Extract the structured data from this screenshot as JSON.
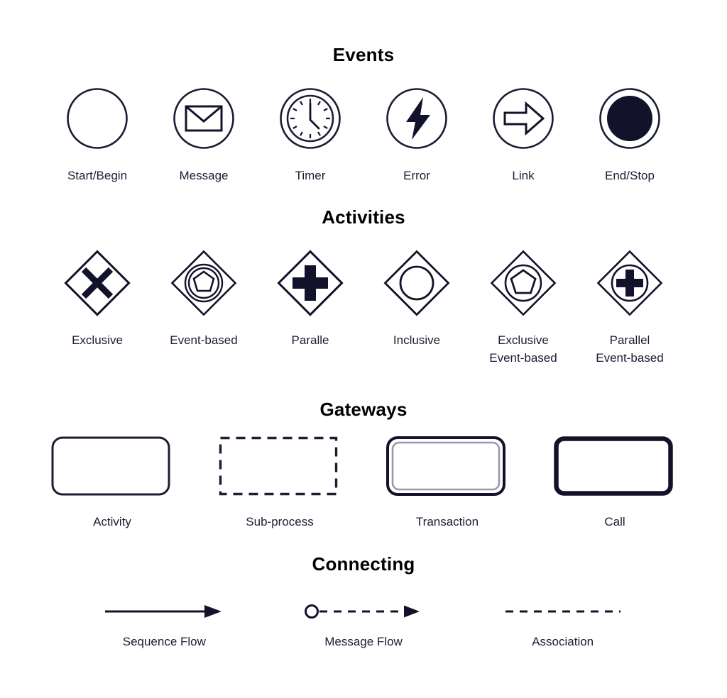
{
  "palette": {
    "ink": "#1b1d33",
    "deep_ink": "#12132a",
    "heading": "#000000",
    "background": "#ffffff",
    "transaction_inner": "#9a9aa6"
  },
  "sections": [
    {
      "id": "events",
      "title": "Events",
      "items": [
        {
          "label": "Start/Begin",
          "icon": "start-event-circle-icon"
        },
        {
          "label": "Message",
          "icon": "message-event-envelope-icon"
        },
        {
          "label": "Timer",
          "icon": "timer-event-clock-icon"
        },
        {
          "label": "Error",
          "icon": "error-event-lightning-icon"
        },
        {
          "label": "Link",
          "icon": "link-event-arrow-icon"
        },
        {
          "label": "End/Stop",
          "icon": "end-event-filled-circle-icon"
        }
      ]
    },
    {
      "id": "activities",
      "title": "Activities",
      "items": [
        {
          "label": "Exclusive",
          "icon": "exclusive-gateway-x-icon"
        },
        {
          "label": "Event-based",
          "icon": "event-based-gateway-double-circle-pentagon-icon"
        },
        {
          "label": "Paralle",
          "icon": "parallel-gateway-plus-icon"
        },
        {
          "label": "Inclusive",
          "icon": "inclusive-gateway-circle-icon"
        },
        {
          "label": "Exclusive\nEvent-based",
          "icon": "exclusive-event-based-gateway-pentagon-icon"
        },
        {
          "label": "Parallel\nEvent-based",
          "icon": "parallel-event-based-gateway-plus-circle-icon"
        }
      ]
    },
    {
      "id": "gateways",
      "title": "Gateways",
      "items": [
        {
          "label": "Activity",
          "icon": "activity-rounded-rect-icon"
        },
        {
          "label": "Sub-process",
          "icon": "subprocess-dashed-rect-icon"
        },
        {
          "label": "Transaction",
          "icon": "transaction-double-border-rect-icon"
        },
        {
          "label": "Call",
          "icon": "call-activity-thick-rect-icon"
        }
      ]
    },
    {
      "id": "connecting",
      "title": "Connecting",
      "items": [
        {
          "label": "Sequence Flow",
          "icon": "sequence-flow-solid-arrow-icon"
        },
        {
          "label": "Message Flow",
          "icon": "message-flow-dashed-arrow-icon"
        },
        {
          "label": "Association",
          "icon": "association-dashed-line-icon"
        }
      ]
    }
  ]
}
